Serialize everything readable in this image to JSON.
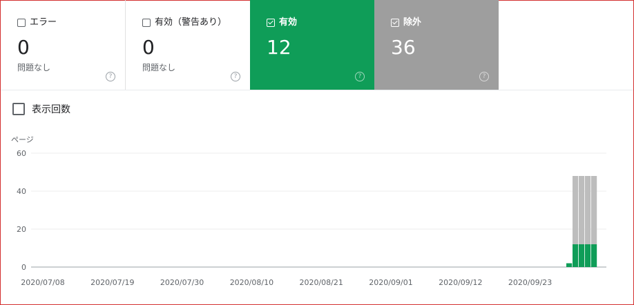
{
  "cards": [
    {
      "label": "エラー",
      "value": "0",
      "sub": "問題なし",
      "checked": false,
      "style": "white"
    },
    {
      "label": "有効（警告あり）",
      "value": "0",
      "sub": "問題なし",
      "checked": false,
      "style": "white"
    },
    {
      "label": "有効",
      "value": "12",
      "sub": "",
      "checked": true,
      "style": "green"
    },
    {
      "label": "除外",
      "value": "36",
      "sub": "",
      "checked": true,
      "style": "gray"
    }
  ],
  "impressions": {
    "label": "表示回数",
    "checked": false
  },
  "chart_data": {
    "type": "bar",
    "ylabel": "ページ",
    "ylim": [
      0,
      60
    ],
    "yticks": [
      "60",
      "40",
      "20",
      "0"
    ],
    "xticks": [
      "2020/07/08",
      "2020/07/19",
      "2020/07/30",
      "2020/08/10",
      "2020/08/21",
      "2020/09/01",
      "2020/09/12",
      "2020/09/23"
    ],
    "series": [
      {
        "name": "有効",
        "color": "#0f9d58",
        "values": [
          2,
          12,
          12,
          12,
          12
        ]
      },
      {
        "name": "除外",
        "color": "#bdbdbd",
        "values": [
          0,
          36,
          36,
          36,
          36
        ]
      }
    ]
  },
  "colors": {
    "valid": "#0f9d58",
    "excluded": "#9e9e9e",
    "border": "#d32f2f"
  },
  "icons": {
    "help": "help-circle-icon",
    "checkbox": "checkbox-icon"
  }
}
